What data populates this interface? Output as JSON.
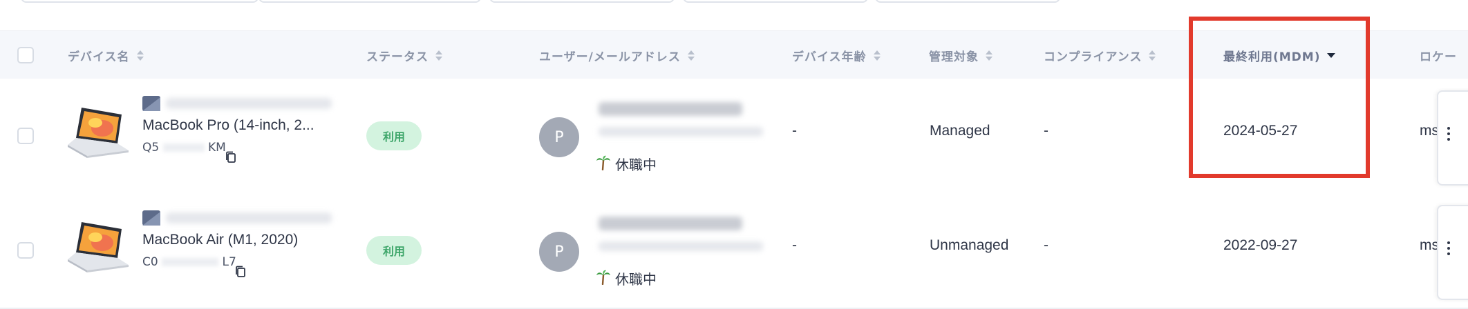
{
  "table": {
    "columns": [
      {
        "key": "device_name",
        "label": "デバイス名",
        "sort": "none"
      },
      {
        "key": "status",
        "label": "ステータス",
        "sort": "none"
      },
      {
        "key": "user_email",
        "label": "ユーザー/メールアドレス",
        "sort": "none"
      },
      {
        "key": "device_age",
        "label": "デバイス年齢",
        "sort": "none"
      },
      {
        "key": "managed",
        "label": "管理対象",
        "sort": "none"
      },
      {
        "key": "compliance",
        "label": "コンプライアンス",
        "sort": "none"
      },
      {
        "key": "last_used",
        "label": "最終利用(MDM)",
        "sort": "descending"
      },
      {
        "key": "location",
        "label": "ロケー",
        "sort": "none"
      }
    ],
    "rows": [
      {
        "model": "MacBook Pro (14-inch, 2...",
        "serial_prefix": "Q5",
        "serial_suffix": "KM",
        "status": "利用",
        "avatar_initial": "P",
        "leave_status": "休職中",
        "device_age": "-",
        "managed": "Managed",
        "compliance": "-",
        "last_used": "2024-05-27",
        "location": "ms"
      },
      {
        "model": "MacBook Air (M1, 2020)",
        "serial_prefix": "C0",
        "serial_suffix": "L7",
        "status": "利用",
        "avatar_initial": "P",
        "leave_status": "休職中",
        "device_age": "-",
        "managed": "Unmanaged",
        "compliance": "-",
        "last_used": "2022-09-27",
        "location": "ms"
      }
    ]
  },
  "colors": {
    "header_bg": "#f5f7fb",
    "status_badge_bg": "#d3f3df",
    "status_badge_text": "#3ea66a",
    "avatar_bg": "#a3a9b5",
    "highlight": "#e23a2c"
  },
  "icons": [
    "laptop-icon",
    "device-type-icon",
    "copy-icon",
    "palm-tree-icon",
    "sort-icon",
    "kebab-menu-icon"
  ]
}
